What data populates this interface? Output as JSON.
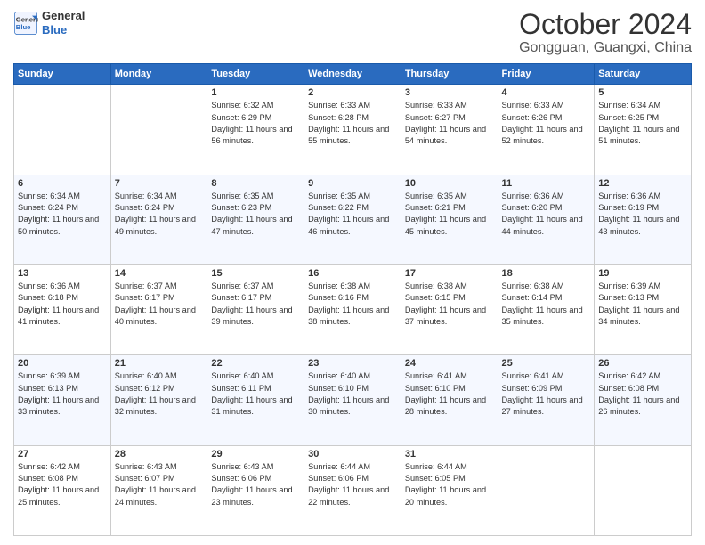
{
  "logo": {
    "line1": "General",
    "line2": "Blue"
  },
  "title": "October 2024",
  "location": "Gongguan, Guangxi, China",
  "days_of_week": [
    "Sunday",
    "Monday",
    "Tuesday",
    "Wednesday",
    "Thursday",
    "Friday",
    "Saturday"
  ],
  "weeks": [
    [
      {
        "day": "",
        "sunrise": "",
        "sunset": "",
        "daylight": ""
      },
      {
        "day": "",
        "sunrise": "",
        "sunset": "",
        "daylight": ""
      },
      {
        "day": "1",
        "sunrise": "Sunrise: 6:32 AM",
        "sunset": "Sunset: 6:29 PM",
        "daylight": "Daylight: 11 hours and 56 minutes."
      },
      {
        "day": "2",
        "sunrise": "Sunrise: 6:33 AM",
        "sunset": "Sunset: 6:28 PM",
        "daylight": "Daylight: 11 hours and 55 minutes."
      },
      {
        "day": "3",
        "sunrise": "Sunrise: 6:33 AM",
        "sunset": "Sunset: 6:27 PM",
        "daylight": "Daylight: 11 hours and 54 minutes."
      },
      {
        "day": "4",
        "sunrise": "Sunrise: 6:33 AM",
        "sunset": "Sunset: 6:26 PM",
        "daylight": "Daylight: 11 hours and 52 minutes."
      },
      {
        "day": "5",
        "sunrise": "Sunrise: 6:34 AM",
        "sunset": "Sunset: 6:25 PM",
        "daylight": "Daylight: 11 hours and 51 minutes."
      }
    ],
    [
      {
        "day": "6",
        "sunrise": "Sunrise: 6:34 AM",
        "sunset": "Sunset: 6:24 PM",
        "daylight": "Daylight: 11 hours and 50 minutes."
      },
      {
        "day": "7",
        "sunrise": "Sunrise: 6:34 AM",
        "sunset": "Sunset: 6:24 PM",
        "daylight": "Daylight: 11 hours and 49 minutes."
      },
      {
        "day": "8",
        "sunrise": "Sunrise: 6:35 AM",
        "sunset": "Sunset: 6:23 PM",
        "daylight": "Daylight: 11 hours and 47 minutes."
      },
      {
        "day": "9",
        "sunrise": "Sunrise: 6:35 AM",
        "sunset": "Sunset: 6:22 PM",
        "daylight": "Daylight: 11 hours and 46 minutes."
      },
      {
        "day": "10",
        "sunrise": "Sunrise: 6:35 AM",
        "sunset": "Sunset: 6:21 PM",
        "daylight": "Daylight: 11 hours and 45 minutes."
      },
      {
        "day": "11",
        "sunrise": "Sunrise: 6:36 AM",
        "sunset": "Sunset: 6:20 PM",
        "daylight": "Daylight: 11 hours and 44 minutes."
      },
      {
        "day": "12",
        "sunrise": "Sunrise: 6:36 AM",
        "sunset": "Sunset: 6:19 PM",
        "daylight": "Daylight: 11 hours and 43 minutes."
      }
    ],
    [
      {
        "day": "13",
        "sunrise": "Sunrise: 6:36 AM",
        "sunset": "Sunset: 6:18 PM",
        "daylight": "Daylight: 11 hours and 41 minutes."
      },
      {
        "day": "14",
        "sunrise": "Sunrise: 6:37 AM",
        "sunset": "Sunset: 6:17 PM",
        "daylight": "Daylight: 11 hours and 40 minutes."
      },
      {
        "day": "15",
        "sunrise": "Sunrise: 6:37 AM",
        "sunset": "Sunset: 6:17 PM",
        "daylight": "Daylight: 11 hours and 39 minutes."
      },
      {
        "day": "16",
        "sunrise": "Sunrise: 6:38 AM",
        "sunset": "Sunset: 6:16 PM",
        "daylight": "Daylight: 11 hours and 38 minutes."
      },
      {
        "day": "17",
        "sunrise": "Sunrise: 6:38 AM",
        "sunset": "Sunset: 6:15 PM",
        "daylight": "Daylight: 11 hours and 37 minutes."
      },
      {
        "day": "18",
        "sunrise": "Sunrise: 6:38 AM",
        "sunset": "Sunset: 6:14 PM",
        "daylight": "Daylight: 11 hours and 35 minutes."
      },
      {
        "day": "19",
        "sunrise": "Sunrise: 6:39 AM",
        "sunset": "Sunset: 6:13 PM",
        "daylight": "Daylight: 11 hours and 34 minutes."
      }
    ],
    [
      {
        "day": "20",
        "sunrise": "Sunrise: 6:39 AM",
        "sunset": "Sunset: 6:13 PM",
        "daylight": "Daylight: 11 hours and 33 minutes."
      },
      {
        "day": "21",
        "sunrise": "Sunrise: 6:40 AM",
        "sunset": "Sunset: 6:12 PM",
        "daylight": "Daylight: 11 hours and 32 minutes."
      },
      {
        "day": "22",
        "sunrise": "Sunrise: 6:40 AM",
        "sunset": "Sunset: 6:11 PM",
        "daylight": "Daylight: 11 hours and 31 minutes."
      },
      {
        "day": "23",
        "sunrise": "Sunrise: 6:40 AM",
        "sunset": "Sunset: 6:10 PM",
        "daylight": "Daylight: 11 hours and 30 minutes."
      },
      {
        "day": "24",
        "sunrise": "Sunrise: 6:41 AM",
        "sunset": "Sunset: 6:10 PM",
        "daylight": "Daylight: 11 hours and 28 minutes."
      },
      {
        "day": "25",
        "sunrise": "Sunrise: 6:41 AM",
        "sunset": "Sunset: 6:09 PM",
        "daylight": "Daylight: 11 hours and 27 minutes."
      },
      {
        "day": "26",
        "sunrise": "Sunrise: 6:42 AM",
        "sunset": "Sunset: 6:08 PM",
        "daylight": "Daylight: 11 hours and 26 minutes."
      }
    ],
    [
      {
        "day": "27",
        "sunrise": "Sunrise: 6:42 AM",
        "sunset": "Sunset: 6:08 PM",
        "daylight": "Daylight: 11 hours and 25 minutes."
      },
      {
        "day": "28",
        "sunrise": "Sunrise: 6:43 AM",
        "sunset": "Sunset: 6:07 PM",
        "daylight": "Daylight: 11 hours and 24 minutes."
      },
      {
        "day": "29",
        "sunrise": "Sunrise: 6:43 AM",
        "sunset": "Sunset: 6:06 PM",
        "daylight": "Daylight: 11 hours and 23 minutes."
      },
      {
        "day": "30",
        "sunrise": "Sunrise: 6:44 AM",
        "sunset": "Sunset: 6:06 PM",
        "daylight": "Daylight: 11 hours and 22 minutes."
      },
      {
        "day": "31",
        "sunrise": "Sunrise: 6:44 AM",
        "sunset": "Sunset: 6:05 PM",
        "daylight": "Daylight: 11 hours and 20 minutes."
      },
      {
        "day": "",
        "sunrise": "",
        "sunset": "",
        "daylight": ""
      },
      {
        "day": "",
        "sunrise": "",
        "sunset": "",
        "daylight": ""
      }
    ]
  ]
}
